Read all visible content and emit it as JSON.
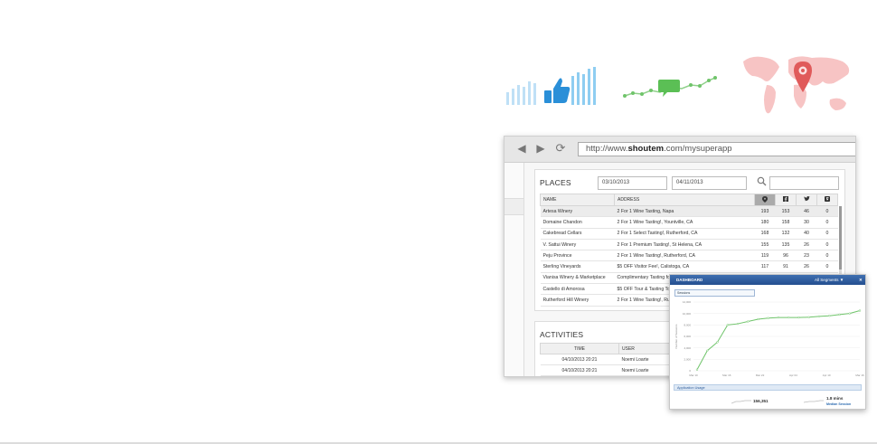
{
  "colors": {
    "accent_blue": "#2a8fd8",
    "accent_green": "#5bbf55",
    "map_pink": "#f6b3b3",
    "pin_red": "#e05a5a",
    "dash_header": "#2d5a9a"
  },
  "browser": {
    "url_prefix": "http://www.",
    "url_domain": "shoutem",
    "url_suffix": ".com/mysuperapp"
  },
  "places": {
    "title": "PLACES",
    "date_from": "03/10/2013",
    "date_to": "04/11/2013",
    "columns": [
      "NAME",
      "ADDRESS"
    ],
    "icon_columns": [
      "pin-icon",
      "facebook-icon",
      "twitter-icon",
      "foursquare-icon"
    ],
    "rows": [
      {
        "name": "Artesa Winery",
        "address": "2 For 1 Wine Tasting, Napa",
        "c1": "193",
        "c2": "153",
        "c3": "46",
        "c4": "0"
      },
      {
        "name": "Domaine Chandon",
        "address": "2 For 1 Wine Tasting!, Yountville, CA",
        "c1": "180",
        "c2": "158",
        "c3": "30",
        "c4": "0"
      },
      {
        "name": "Cakebread Cellars",
        "address": "2 For 1 Select Tasting!, Rutherford, CA",
        "c1": "168",
        "c2": "132",
        "c3": "40",
        "c4": "0"
      },
      {
        "name": "V. Sattui Winery",
        "address": "2 For 1 Premium Tasting!, St Helena, CA",
        "c1": "155",
        "c2": "135",
        "c3": "26",
        "c4": "0"
      },
      {
        "name": "Peju Province",
        "address": "2 For 1 Wine Tasting!, Rutherford, CA",
        "c1": "119",
        "c2": "96",
        "c3": "23",
        "c4": "0"
      },
      {
        "name": "Sterling Vineyards",
        "address": "$5 OFF Visitor Fee!, Calistoga, CA",
        "c1": "117",
        "c2": "91",
        "c3": "26",
        "c4": "0"
      },
      {
        "name": "Vianisa Winery & Marketplace",
        "address": "Complimentary Tasting for",
        "c1": "",
        "c2": "",
        "c3": "",
        "c4": ""
      },
      {
        "name": "Castello di Amorosa",
        "address": "$5 OFF Tour & Tasting To",
        "c1": "",
        "c2": "",
        "c3": "",
        "c4": ""
      },
      {
        "name": "Rutherford Hill Winery",
        "address": "2 For 1 Wine Tasting!, Rut",
        "c1": "",
        "c2": "",
        "c3": "",
        "c4": ""
      }
    ]
  },
  "activities": {
    "title": "ACTIVITIES",
    "columns": [
      "TIME",
      "USER"
    ],
    "rows": [
      {
        "time": "04/10/2013 20:21",
        "user": "Noemi Loarte"
      },
      {
        "time": "04/10/2013 20:21",
        "user": "Noemi Loarte"
      }
    ]
  },
  "dashboard": {
    "title": "DASHBOARD",
    "segment": "All Segments ▼",
    "metric": "Sessions",
    "y_axis_label": "Number of Sessions",
    "usage_title": "Application Usage",
    "stat_sessions": "156,351",
    "stat_median": "1.8 mins",
    "stat_median_label": "Median Session"
  },
  "chart_data": {
    "type": "line",
    "title": "",
    "xlabel": "",
    "ylabel": "Number of Sessions",
    "x": [
      "Mar 10",
      "",
      "Mar 16",
      "",
      "Mar 22",
      "",
      "Apr 04",
      "",
      "Apr 10",
      "",
      "Mar 16"
    ],
    "x_ticks": [
      "Mar 10",
      "Mar 16",
      "Mar 22",
      "Apr 04",
      "Apr 10",
      "Mar 16"
    ],
    "y_ticks": [
      "0",
      "2,000",
      "4,000",
      "6,000",
      "8,000",
      "10,000",
      "12,000"
    ],
    "ylim": [
      0,
      12000
    ],
    "series": [
      {
        "name": "",
        "values": [
          200,
          3500,
          5000,
          8000,
          8200,
          8600,
          9000,
          9200,
          9300,
          9300,
          9300,
          9350,
          9500,
          9600,
          9800,
          10000,
          10500
        ]
      }
    ],
    "grid": true
  }
}
